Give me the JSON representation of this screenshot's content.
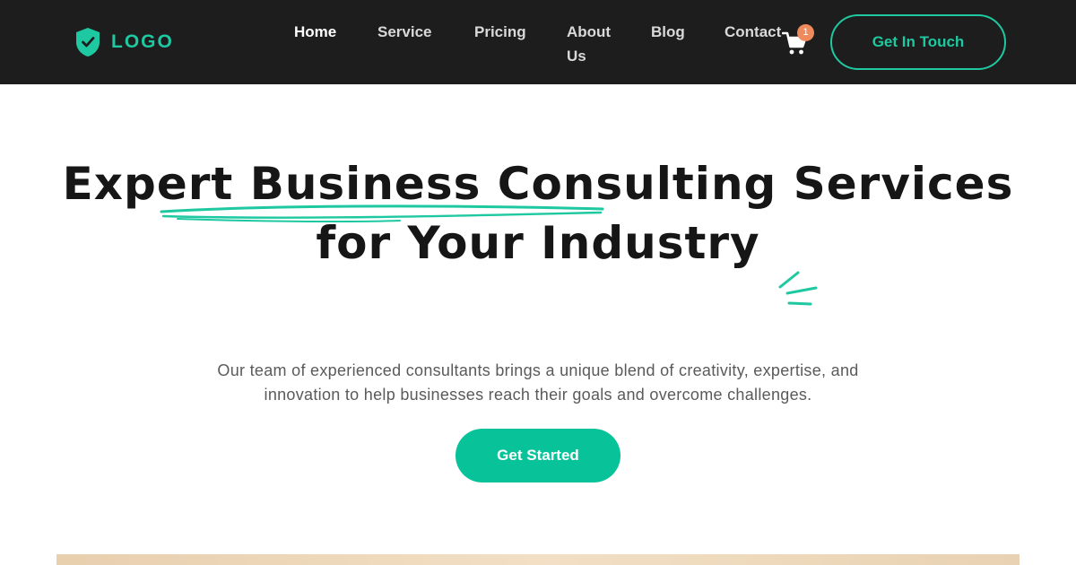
{
  "brand": {
    "logo_text": "LOGO",
    "accent_color": "#1ec8a0",
    "logo_icon": "shield-check-icon"
  },
  "nav": {
    "items": [
      {
        "label": "Home",
        "active": true
      },
      {
        "label": "Service",
        "active": false
      },
      {
        "label": "Pricing",
        "active": false
      },
      {
        "label": "About Us",
        "active": false
      },
      {
        "label": "Blog",
        "active": false
      },
      {
        "label": "Contact",
        "active": false
      }
    ],
    "cart_icon": "shopping-cart-icon",
    "cart_count": "1",
    "cta_label": "Get In Touch"
  },
  "hero": {
    "headline_highlight": "Expert Business",
    "headline_rest": " Consulting Services",
    "headline_line2": "for Your Industry",
    "subtext_line1": "Our team of experienced consultants brings a unique blend of creativity, expertise, and",
    "subtext_line2": "innovation to help businesses reach their goals and overcome challenges.",
    "cta_label": "Get Started"
  },
  "colors": {
    "header_bg": "#1d1d1d",
    "primary_button": "#08c39a",
    "badge": "#ef8a5d",
    "image_strip": "#e8cfae"
  }
}
